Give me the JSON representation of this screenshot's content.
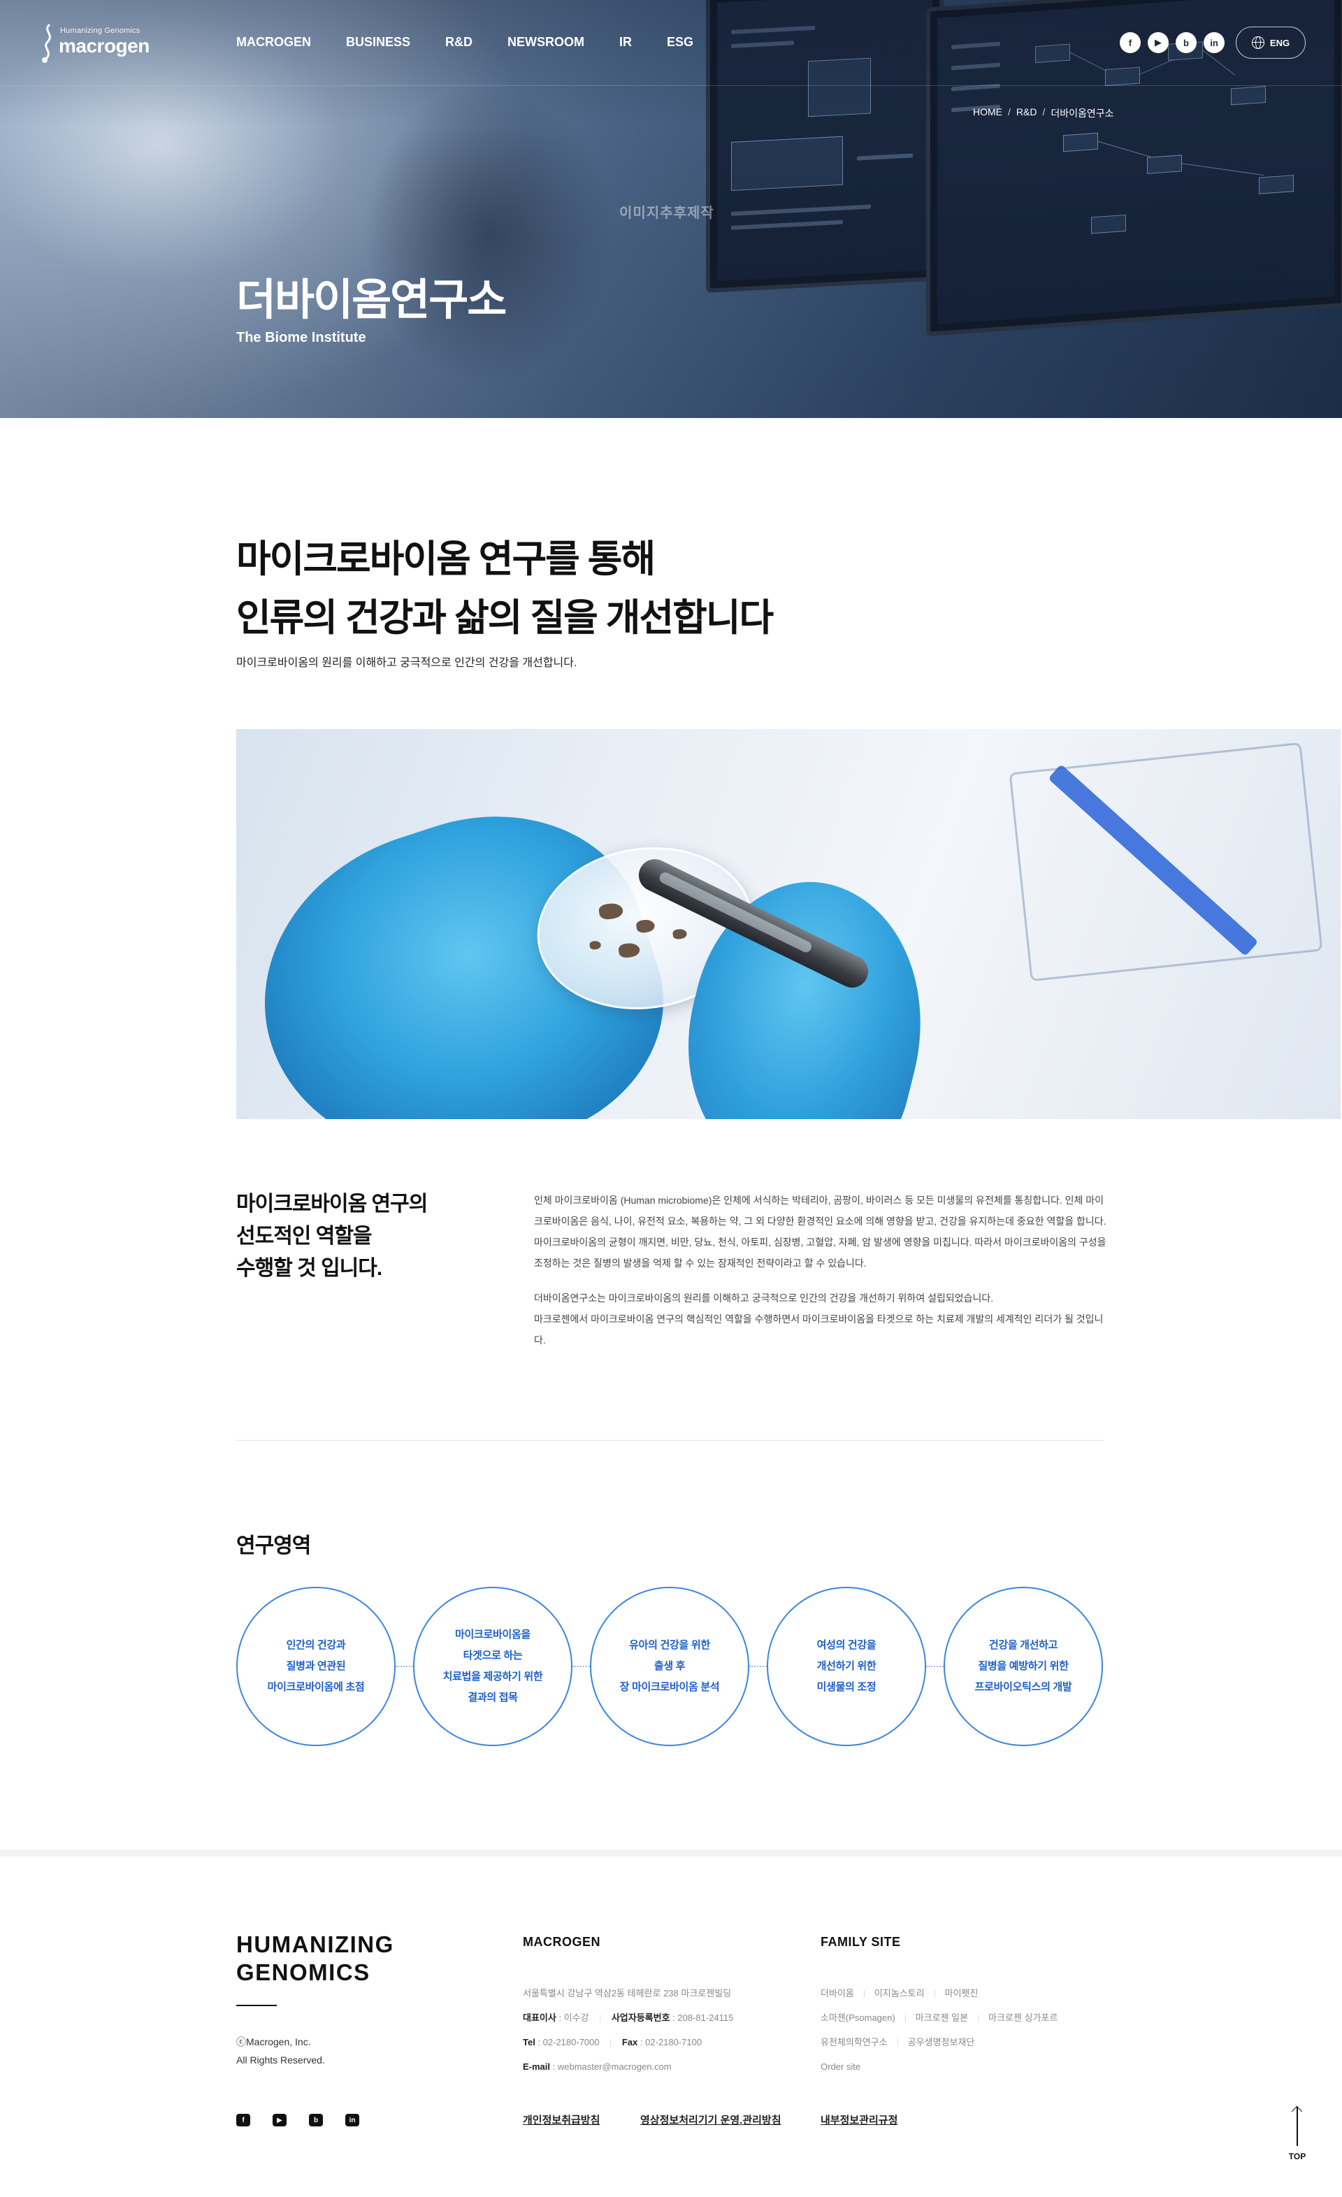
{
  "header": {
    "logo_tagline": "Humanizing Genomics",
    "logo_name": "macrogen",
    "nav": [
      "MACROGEN",
      "BUSINESS",
      "R&D",
      "NEWSROOM",
      "IR",
      "ESG"
    ],
    "sns": [
      {
        "icon": "facebook-icon",
        "glyph": "f"
      },
      {
        "icon": "youtube-icon",
        "glyph": "▶"
      },
      {
        "icon": "blog-icon",
        "glyph": "b"
      },
      {
        "icon": "linkedin-icon",
        "glyph": "in"
      }
    ],
    "lang_label": "ENG"
  },
  "hero": {
    "breadcrumb": [
      "HOME",
      "R&D",
      "더바이옴연구소"
    ],
    "watermark": "이미지추후제작",
    "title": "더바이옴연구소",
    "subtitle": "The Biome Institute"
  },
  "intro": {
    "headline_1": "마이크로바이옴 연구를 통해",
    "headline_2": "인류의 건강과 삶의 질을 개선합니다",
    "description": "마이크로바이옴의 원리를 이해하고 궁극적으로 인간의 건강을 개선합니다."
  },
  "role": {
    "heading_1": "마이크로바이옴 연구의",
    "heading_2": "선도적인 역할을",
    "heading_3": "수행할  것  입니다.",
    "paragraph_1": "인체 마이크로바이옴 (Human microbiome)은 인체에 서식하는 박테리아, 곰팡이, 바이러스 등 모든 미생물의 유전체를 통칭합니다. 인체 마이크로바이옴은 음식, 나이, 유전적 요소, 복용하는 약, 그 외 다양한 환경적인 요소에 의해 영향을 받고, 건강을 유지하는데 중요한 역할을 합니다. 마이크로바이옴의 균형이 깨지면, 비만, 당뇨, 천식, 아토피, 심장병, 고혈압, 자폐, 암 발생에 영향을 미칩니다. 따라서 마이크로바이옴의 구성을 조정하는 것은 질병의 발생을 억제 할 수 있는 잠재적인 전략이라고 할 수 있습니다.",
    "paragraph_2a": "더바이옴연구소는 마이크로바이옴의 원리를 이해하고 궁극적으로 인간의 건강을 개선하기 위하여 설립되었습니다.",
    "paragraph_2b": "마크로젠에서 마이크로바이옴 연구의 핵심적인 역할을 수행하면서 마이크로바이옴을 타겟으로 하는 치료제 개발의 세계적인 리더가 될 것입니다."
  },
  "areas": {
    "title": "연구영역",
    "items": [
      [
        "인간의 건강과",
        "질병과 연관된",
        "마이크로바이옴에 초점"
      ],
      [
        "마이크로바이옴을",
        "타겟으로 하는",
        "치료법을 제공하기 위한",
        "결과의 접목"
      ],
      [
        "유아의 건강을 위한",
        "출생 후",
        "장 마이크로바이옴 분석"
      ],
      [
        "여성의 건강을",
        "개선하기 위한",
        "미생물의 조정"
      ],
      [
        "건강을 개선하고",
        "질병을 예방하기 위한",
        "프로바이오틱스의 개발"
      ]
    ],
    "accent_color": "#3a86e4"
  },
  "footer": {
    "brand_1": "HUMANIZING",
    "brand_2": "GENOMICS",
    "copyright_1": "ⓒMacrogen, Inc.",
    "copyright_2": "All Rights Reserved.",
    "macrogen_title": "MACROGEN",
    "address": "서울특별시 강남구 역삼2동 테헤란로 238 마크로젠빌딩",
    "ceo_label": "대표이사",
    "ceo_value": " : 이수강",
    "bizno_label": "사업자등록번호",
    "bizno_value": " : 208-81-24115",
    "tel_label": "Tel",
    "tel_value": " : 02-2180-7000",
    "fax_label": "Fax",
    "fax_value": " : 02-2180-7100",
    "email_label": "E-mail",
    "email_value": " : webmaster@macrogen.com",
    "family_title": "FAMILY SITE",
    "family_row1": [
      "더바이옴",
      "이지놈스토리",
      "마이펫진"
    ],
    "family_row2": [
      "소마젠(Psomagen)",
      "마크로젠 일본",
      "마크로젠 싱가포르"
    ],
    "family_row3": [
      "유전체의학연구소",
      "공우생명정보재단"
    ],
    "family_row4": [
      "Order site"
    ],
    "link_privacy": "개인정보취급방침",
    "link_cctv": "영상정보처리기기 운영.관리방침",
    "link_internal": "내부정보관리규정",
    "top_label": "TOP",
    "sns": [
      {
        "icon": "facebook-icon",
        "glyph": "f"
      },
      {
        "icon": "youtube-icon",
        "glyph": "▶"
      },
      {
        "icon": "blog-icon",
        "glyph": "b"
      },
      {
        "icon": "linkedin-icon",
        "glyph": "in"
      }
    ]
  }
}
